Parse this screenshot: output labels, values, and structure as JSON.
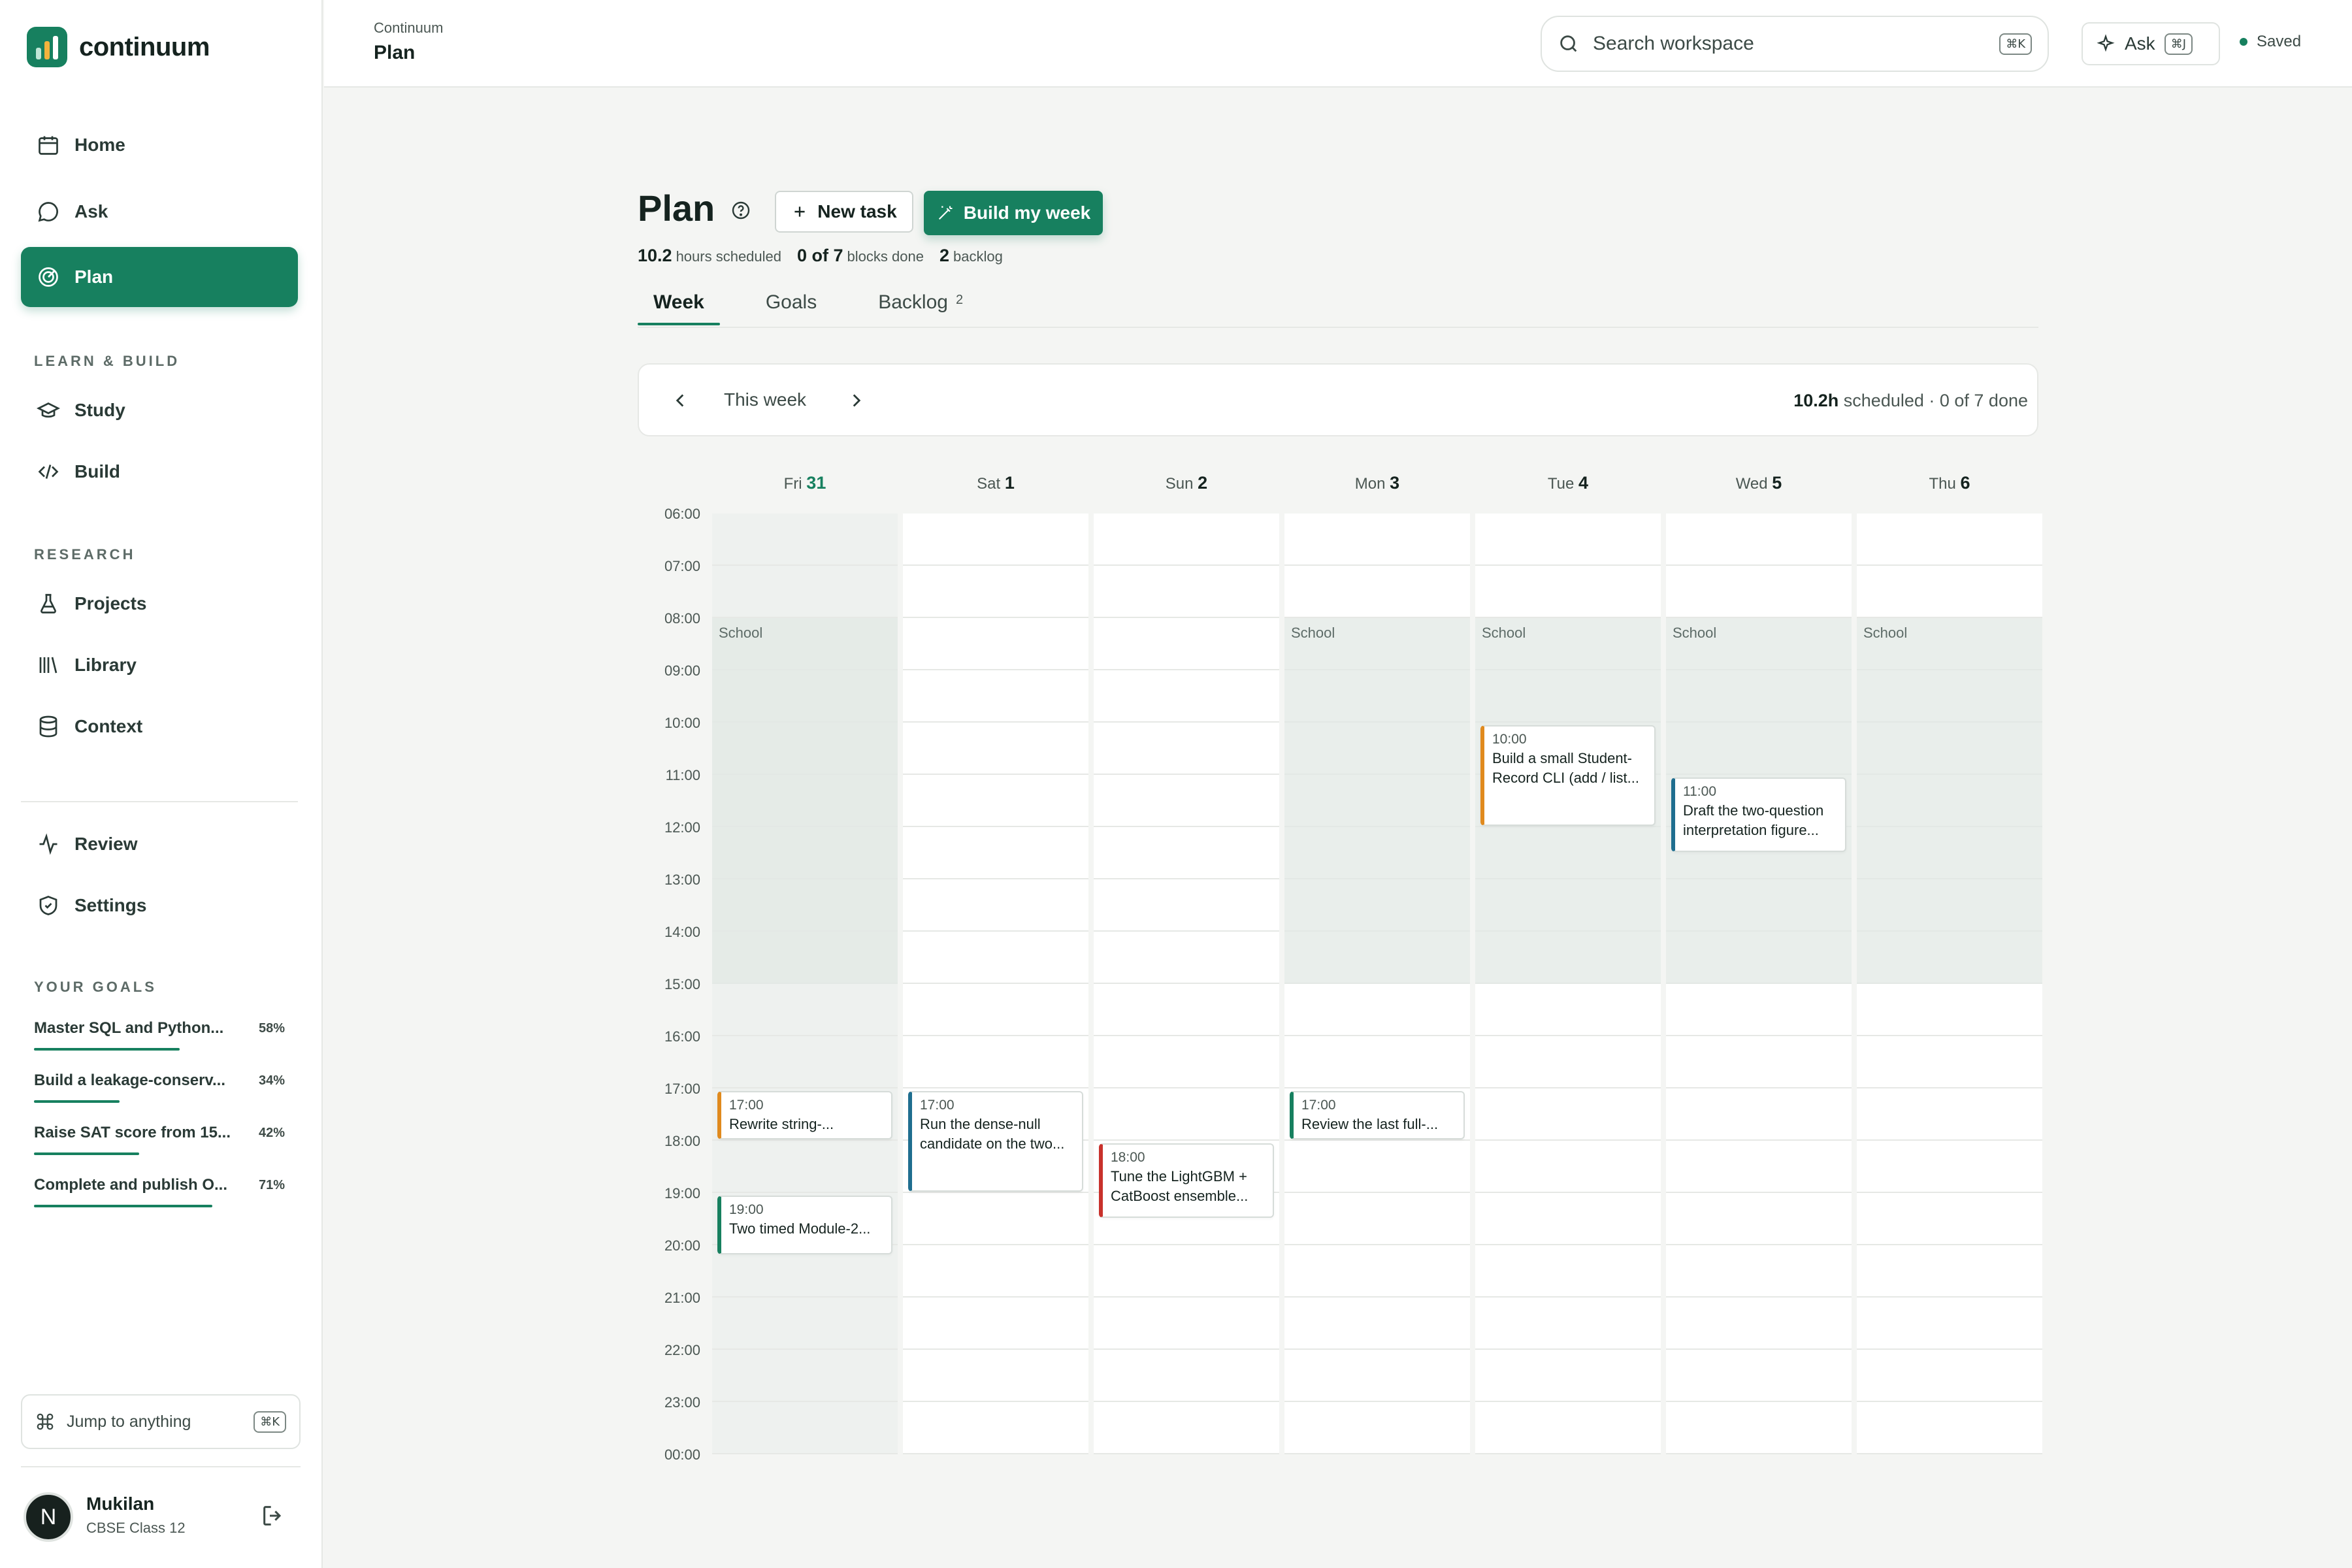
{
  "brand": {
    "name": "continuum"
  },
  "sidebar": {
    "nav": [
      {
        "label": "Home",
        "icon": "calendar-icon"
      },
      {
        "label": "Ask",
        "icon": "chat-bubble-icon"
      },
      {
        "label": "Plan",
        "icon": "target-icon",
        "active": true
      }
    ],
    "learn_label": "LEARN & BUILD",
    "learn": [
      {
        "label": "Study",
        "icon": "graduation-cap-icon"
      },
      {
        "label": "Build",
        "icon": "code-icon"
      }
    ],
    "research_label": "RESEARCH",
    "research": [
      {
        "label": "Projects",
        "icon": "flask-icon"
      },
      {
        "label": "Library",
        "icon": "library-icon"
      },
      {
        "label": "Context",
        "icon": "database-icon"
      }
    ],
    "other": [
      {
        "label": "Review",
        "icon": "activity-icon"
      },
      {
        "label": "Settings",
        "icon": "shield-icon"
      }
    ],
    "goals_label": "YOUR GOALS",
    "goals": [
      {
        "name": "Master SQL and Python...",
        "pct": "58%",
        "fill": 0.58
      },
      {
        "name": "Build a leakage-conserv...",
        "pct": "34%",
        "fill": 0.34
      },
      {
        "name": "Raise SAT score from 15...",
        "pct": "42%",
        "fill": 0.42
      },
      {
        "name": "Complete and publish O...",
        "pct": "71%",
        "fill": 0.71
      }
    ],
    "jump": {
      "label": "Jump to anything",
      "kbd": "⌘K"
    },
    "user": {
      "initial": "N",
      "name": "Mukilan",
      "sub": "CBSE Class 12"
    }
  },
  "topbar": {
    "crumb": "Continuum",
    "title": "Plan",
    "search_placeholder": "Search workspace",
    "search_kbd": "⌘K",
    "ask_label": "Ask",
    "ask_kbd": "⌘J",
    "saved": "Saved"
  },
  "main": {
    "title": "Plan",
    "new_task": "New task",
    "build_week": "Build my week",
    "stats": {
      "hours": "10.2",
      "hours_label": "hours scheduled",
      "blocks": "0 of 7",
      "blocks_label": "blocks done",
      "backlog": "2",
      "backlog_label": "backlog"
    },
    "tabs": [
      {
        "label": "Week",
        "active": true,
        "badge": ""
      },
      {
        "label": "Goals",
        "active": false,
        "badge": ""
      },
      {
        "label": "Backlog",
        "active": false,
        "badge": "2"
      }
    ],
    "week": {
      "label": "This week",
      "summary_bold": "10.2h",
      "summary_rest": "scheduled · 0 of 7 done"
    },
    "times": [
      "06:00",
      "07:00",
      "08:00",
      "09:00",
      "10:00",
      "11:00",
      "12:00",
      "13:00",
      "14:00",
      "15:00",
      "16:00",
      "17:00",
      "18:00",
      "19:00",
      "20:00",
      "21:00",
      "22:00",
      "23:00",
      "00:00"
    ],
    "days": [
      {
        "dow": "Fri",
        "num": "31",
        "today": true,
        "school": true
      },
      {
        "dow": "Sat",
        "num": "1",
        "today": false,
        "school": false
      },
      {
        "dow": "Sun",
        "num": "2",
        "today": false,
        "school": false
      },
      {
        "dow": "Mon",
        "num": "3",
        "today": false,
        "school": true
      },
      {
        "dow": "Tue",
        "num": "4",
        "today": false,
        "school": true
      },
      {
        "dow": "Wed",
        "num": "5",
        "today": false,
        "school": true
      },
      {
        "dow": "Thu",
        "num": "6",
        "today": false,
        "school": true
      }
    ],
    "school_label": "School",
    "events": [
      {
        "day": 0,
        "start": 17,
        "hours": 1,
        "time": "17:00",
        "title": "Rewrite string-...",
        "lines": 1,
        "color": "#e08a1e"
      },
      {
        "day": 0,
        "start": 19,
        "hours": 1.2,
        "time": "19:00",
        "title": "Two timed Module-2...",
        "lines": 1,
        "color": "#17805f"
      },
      {
        "day": 1,
        "start": 17,
        "hours": 2,
        "time": "17:00",
        "title": "Run the dense-null candidate on the two...",
        "lines": 2,
        "color": "#1f6e8f"
      },
      {
        "day": 2,
        "start": 18,
        "hours": 1.5,
        "time": "18:00",
        "title": "Tune the LightGBM + CatBoost ensemble...",
        "lines": 2,
        "color": "#c8312b"
      },
      {
        "day": 3,
        "start": 17,
        "hours": 1,
        "time": "17:00",
        "title": "Review the last full-...",
        "lines": 1,
        "color": "#17805f"
      },
      {
        "day": 4,
        "start": 10,
        "hours": 2,
        "time": "10:00",
        "title": "Build a small Student-Record CLI (add / list...",
        "lines": 2,
        "color": "#e08a1e"
      },
      {
        "day": 5,
        "start": 11,
        "hours": 1.5,
        "time": "11:00",
        "title": "Draft the two-question interpretation figure...",
        "lines": 2,
        "color": "#1f6e8f"
      }
    ]
  }
}
